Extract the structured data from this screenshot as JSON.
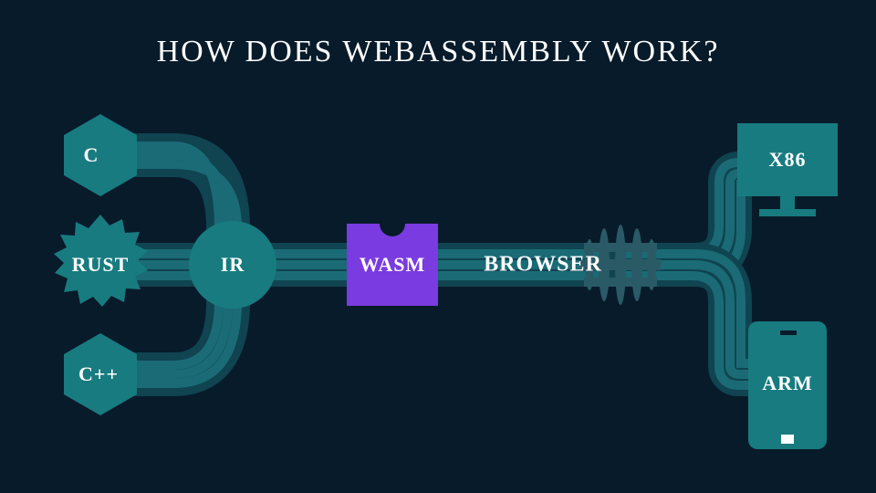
{
  "title": "HOW DOES WEBASSEMBLY WORK?",
  "nodes": {
    "c": "C",
    "rust": "RUST",
    "cpp": "C++",
    "ir": "IR",
    "wasm": "WASM",
    "browser": "BROWSER",
    "x86": "X86",
    "arm": "ARM"
  },
  "colors": {
    "bg": "#081b2b",
    "teal": "#187b7f",
    "tealDark": "#0f5a63",
    "tealMuted": "#2a5a66",
    "purple": "#7a3be0",
    "white": "#ffffff"
  }
}
